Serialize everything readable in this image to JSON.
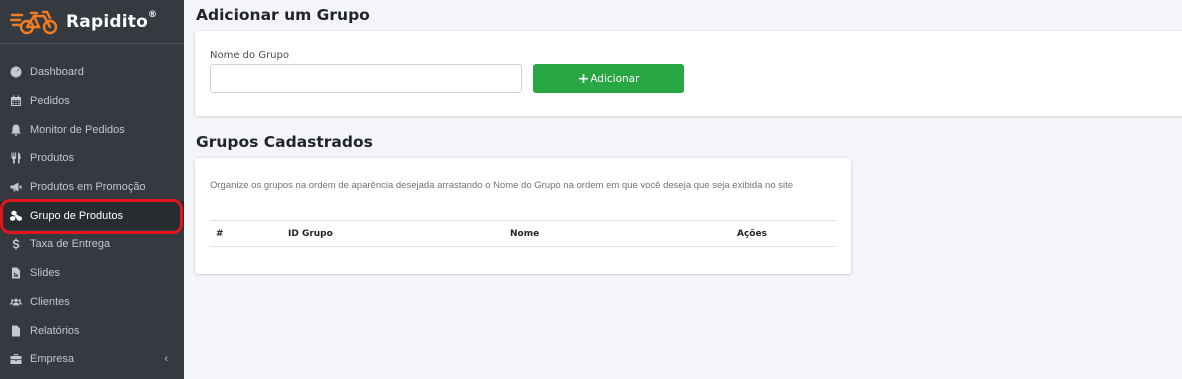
{
  "brand": {
    "name": "Rapidito",
    "mark": "®"
  },
  "sidebar": {
    "items": [
      {
        "label": "Dashboard",
        "icon": "dashboard-icon"
      },
      {
        "label": "Pedidos",
        "icon": "calendar-icon"
      },
      {
        "label": "Monitor de Pedidos",
        "icon": "bell-icon"
      },
      {
        "label": "Produtos",
        "icon": "utensils-icon"
      },
      {
        "label": "Produtos em Promoção",
        "icon": "megaphone-icon"
      },
      {
        "label": "Grupo de Produtos",
        "icon": "cubes-icon",
        "active": true
      },
      {
        "label": "Taxa de Entrega",
        "icon": "dollar-icon"
      },
      {
        "label": "Slides",
        "icon": "file-image-icon"
      },
      {
        "label": "Clientes",
        "icon": "users-icon"
      },
      {
        "label": "Relatórios",
        "icon": "file-icon"
      },
      {
        "label": "Empresa",
        "icon": "briefcase-icon",
        "chevron": "‹"
      }
    ]
  },
  "add_group": {
    "title": "Adicionar um Grupo",
    "field_label": "Nome do Grupo",
    "field_value": "",
    "button_label": "Adicionar"
  },
  "groups": {
    "title": "Grupos Cadastrados",
    "description": "Organize os grupos na ordem de aparência desejada arrastando o Nome do Grupo na ordem em que você deseja que seja exibida no site",
    "columns": [
      "#",
      "ID Grupo",
      "Nome",
      "Ações"
    ],
    "rows": []
  },
  "colors": {
    "sidebar": "#343a40",
    "active": "#272c30",
    "accent": "#28a745",
    "highlight": "#e4141c",
    "brand_orange": "#f47c20"
  }
}
